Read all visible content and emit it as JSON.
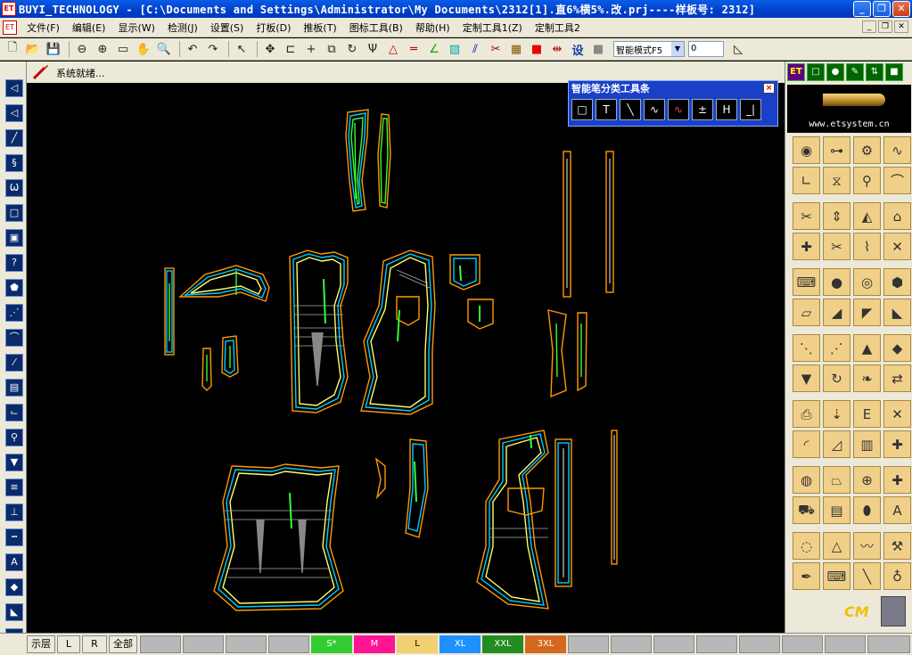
{
  "window": {
    "app_icon": "ET",
    "title": "BUYI_TECHNOLOGY - [C:\\Documents and Settings\\Administrator\\My Documents\\2312[1].直6%横5%.改.prj----样板号: 2312]"
  },
  "menu": {
    "items": [
      "文件(F)",
      "编辑(E)",
      "显示(W)",
      "检测(J)",
      "设置(S)",
      "打板(D)",
      "推板(T)",
      "图标工具(B)",
      "帮助(H)",
      "定制工具1(Z)",
      "定制工具2"
    ]
  },
  "toolbar": {
    "mode_value": "智能模式F5",
    "number_value": "0",
    "she_label": "设"
  },
  "status": {
    "message": "系统就绪..."
  },
  "float_toolbox": {
    "title": "智能笔分类工具条",
    "close": "×"
  },
  "right_panel": {
    "url": "www.etsystem.cn",
    "logo": "CM"
  },
  "bottom": {
    "layer_label": "示层",
    "l_label": "L",
    "r_label": "R",
    "all_label": "全部",
    "sizes": [
      {
        "label": "S*",
        "color": "#33cc33"
      },
      {
        "label": "M",
        "color": "#ff1493"
      },
      {
        "label": "L",
        "color": "#f0d070"
      },
      {
        "label": "XL",
        "color": "#1e90ff"
      },
      {
        "label": "XXL",
        "color": "#228b22"
      },
      {
        "label": "3XL",
        "color": "#d2691e"
      }
    ]
  },
  "colors": {
    "canvas": "#000000",
    "pattern_outline": "#ff9900",
    "seam_line": "#33ff33"
  }
}
